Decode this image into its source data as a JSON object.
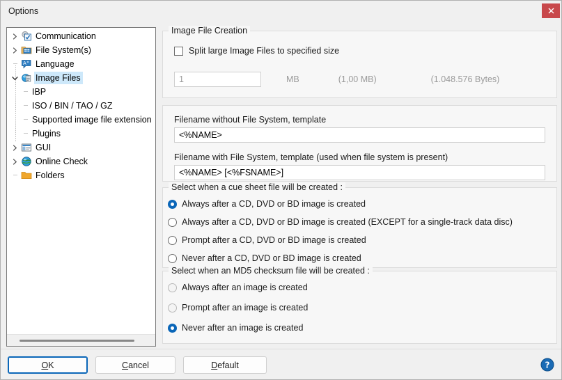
{
  "window": {
    "title": "Options",
    "close_icon": "close-icon"
  },
  "tree": {
    "items": [
      {
        "label": "Communication",
        "icon": "communication-gear-icon",
        "level": 0,
        "expandable": true,
        "expanded": false,
        "selected": false
      },
      {
        "label": "File System(s)",
        "icon": "file-system-icon",
        "level": 0,
        "expandable": true,
        "expanded": false,
        "selected": false
      },
      {
        "label": "Language",
        "icon": "language-icon",
        "level": 0,
        "expandable": false,
        "expanded": false,
        "selected": false
      },
      {
        "label": "Image Files",
        "icon": "image-files-icon",
        "level": 0,
        "expandable": true,
        "expanded": true,
        "selected": true
      },
      {
        "label": "IBP",
        "icon": "none",
        "level": 1,
        "expandable": false,
        "expanded": false,
        "selected": false
      },
      {
        "label": "ISO / BIN / TAO / GZ",
        "icon": "none",
        "level": 1,
        "expandable": false,
        "expanded": false,
        "selected": false
      },
      {
        "label": "Supported image file extension",
        "icon": "none",
        "level": 1,
        "expandable": false,
        "expanded": false,
        "selected": false
      },
      {
        "label": "Plugins",
        "icon": "none",
        "level": 1,
        "expandable": false,
        "expanded": false,
        "selected": false
      },
      {
        "label": "GUI",
        "icon": "gui-icon",
        "level": 0,
        "expandable": true,
        "expanded": false,
        "selected": false
      },
      {
        "label": "Online Check",
        "icon": "online-check-globe-icon",
        "level": 0,
        "expandable": true,
        "expanded": false,
        "selected": false
      },
      {
        "label": "Folders",
        "icon": "folder-icon",
        "level": 0,
        "expandable": false,
        "expanded": false,
        "selected": false
      }
    ]
  },
  "image_file_creation": {
    "legend": "Image File Creation",
    "split_checkbox_label": "Split large Image Files to specified size",
    "split_checked": false,
    "size_value": "1",
    "size_unit": "MB",
    "size_mb_text": "(1,00 MB)",
    "size_bytes_text": "(1.048.576 Bytes)"
  },
  "filename": {
    "label_without_fs": "Filename without File System, template",
    "value_without_fs": "<%NAME>",
    "label_with_fs": "Filename with File System, template (used when file system is present)",
    "value_with_fs": "<%NAME> [<%FSNAME>]"
  },
  "cue_sheet": {
    "legend": "Select when a cue sheet file will be created :",
    "options": [
      {
        "label": "Always after a CD, DVD or BD image is created",
        "checked": true,
        "disabled": false
      },
      {
        "label": "Always after a CD, DVD or BD image is created (EXCEPT for a single-track data disc)",
        "checked": false,
        "disabled": false
      },
      {
        "label": "Prompt after a CD, DVD or BD image is created",
        "checked": false,
        "disabled": false
      },
      {
        "label": "Never after a CD, DVD or BD image is created",
        "checked": false,
        "disabled": false
      }
    ]
  },
  "md5": {
    "legend": "Select when an MD5 checksum file will be created :",
    "options": [
      {
        "label": "Always after an image is created",
        "checked": false,
        "disabled": true
      },
      {
        "label": "Prompt after an image is created",
        "checked": false,
        "disabled": true
      },
      {
        "label": "Never after an image is created",
        "checked": true,
        "disabled": false
      }
    ]
  },
  "buttons": {
    "ok": {
      "label": "OK",
      "mnemonic": "O",
      "focused": true
    },
    "cancel": {
      "label": "Cancel",
      "mnemonic": "C",
      "focused": false
    },
    "default": {
      "label": "Default",
      "mnemonic": "D",
      "focused": false
    },
    "help_icon": "help-question-icon"
  },
  "colors": {
    "accent": "#0a66b8",
    "selection": "#cde8fa",
    "close_button": "#c8484b",
    "window_bg": "#f0f0f0",
    "group_bg": "#f7f7f7"
  }
}
